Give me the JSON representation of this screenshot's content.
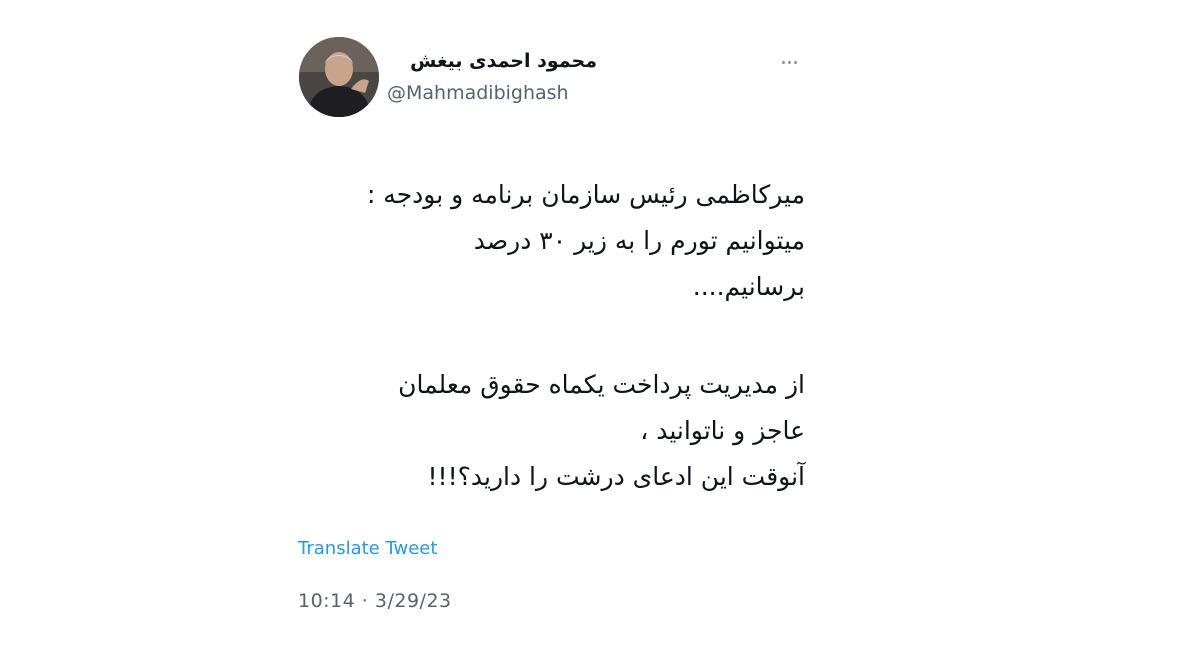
{
  "tweet": {
    "author": {
      "display_name": "محمود احمدی بیغش",
      "handle": "@Mahmadibighash"
    },
    "text_paragraph_1": [
      "میرکاظمی رئیس سازمان برنامه و بودجه :",
      "میتوانیم تورم را به زیر ۳۰ درصد",
      "برسانیم...."
    ],
    "text_paragraph_2": [
      "از مدیریت پرداخت یکماه حقوق معلمان",
      "عاجز و ناتوانید ،",
      "آنوقت این ادعای درشت را دارید؟!!!"
    ],
    "translate_label": "Translate Tweet",
    "timestamp": "10:14 · 3/29/23",
    "more_icon": "more-horizontal-icon",
    "colors": {
      "link": "#1d9bf0",
      "secondary_text": "#536471",
      "primary_text": "#0f1419"
    }
  }
}
